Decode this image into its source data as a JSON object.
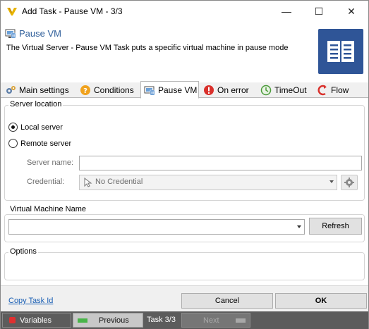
{
  "window": {
    "title": "Add Task - Pause VM - 3/3",
    "minimize_glyph": "—",
    "maximize_glyph": "☐",
    "close_glyph": "✕"
  },
  "header": {
    "task_name": "Pause VM",
    "description": "The Virtual Server - Pause VM Task puts a specific virtual machine in pause mode",
    "tile_color": "#2f5597"
  },
  "tabs": [
    {
      "label": "Main settings",
      "icon": "gears-icon",
      "active": false
    },
    {
      "label": "Conditions",
      "icon": "question-icon",
      "active": false
    },
    {
      "label": "Pause VM",
      "icon": "task-icon",
      "active": true
    },
    {
      "label": "On error",
      "icon": "error-icon",
      "active": false
    },
    {
      "label": "TimeOut",
      "icon": "timeout-icon",
      "active": false
    },
    {
      "label": "Flow",
      "icon": "flow-icon",
      "active": false
    }
  ],
  "server_location": {
    "group_label": "Server location",
    "local_label": "Local server",
    "remote_label": "Remote server",
    "selected": "local",
    "server_name_label": "Server name:",
    "server_name_value": "",
    "credential_label": "Credential:",
    "credential_value": "No Credential"
  },
  "vm": {
    "group_label": "Virtual Machine Name",
    "value": "",
    "refresh_label": "Refresh"
  },
  "options": {
    "group_label": "Options"
  },
  "footer": {
    "copy_task_id": "Copy Task Id",
    "cancel_label": "Cancel",
    "ok_label": "OK"
  },
  "statusbar": {
    "variables_label": "Variables",
    "previous_label": "Previous",
    "task_counter": "Task 3/3",
    "next_label": "Next"
  },
  "colors": {
    "accent_blue": "#2e5e9a",
    "link_blue": "#1a5fb4",
    "statusbar_bg": "#5c5c5c"
  }
}
